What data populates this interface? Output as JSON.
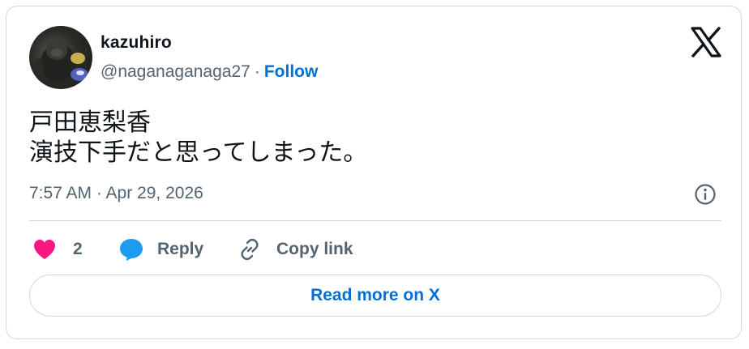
{
  "author": {
    "name": "kazuhiro",
    "handle": "@naganaganaga27",
    "separator": "·",
    "follow_label": "Follow"
  },
  "tweet": {
    "lines": [
      "戸田恵梨香",
      "演技下手だと思ってしまった。"
    ],
    "timestamp": "7:57 AM · Apr 29, 2026"
  },
  "actions": {
    "like_count": "2",
    "reply_label": "Reply",
    "copy_label": "Copy link"
  },
  "footer": {
    "read_more_label": "Read more on X"
  },
  "icons": {
    "brand": "x-logo-icon",
    "info": "info-icon",
    "like": "heart-icon",
    "reply": "speech-bubble-icon",
    "copy": "link-icon"
  },
  "colors": {
    "like": "#f91880",
    "reply": "#1d9bf0",
    "link": "#006fd6",
    "secondary_text": "#536471",
    "primary_text": "#0f1419",
    "border": "#cfd9de"
  }
}
